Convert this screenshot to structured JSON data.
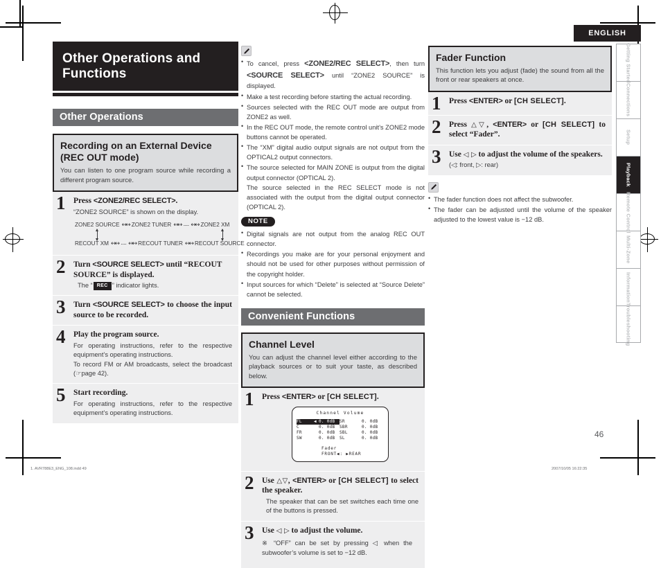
{
  "page": {
    "language_banner": "ENGLISH",
    "page_number": "46",
    "footer_left": "1. AVR788E3_ENG_108.indd    49",
    "footer_right": "2007/10/05   16:22:35"
  },
  "sidebar": {
    "tabs": [
      {
        "label": "Getting Started",
        "active": false
      },
      {
        "label": "Connections",
        "active": false
      },
      {
        "label": "Setup",
        "active": false
      },
      {
        "label": "Playback",
        "active": true
      },
      {
        "label": "Remote Control",
        "active": false
      },
      {
        "label": "Multi-Zone",
        "active": false
      },
      {
        "label": "Information",
        "active": false
      },
      {
        "label": "Troubleshooting",
        "active": false
      }
    ]
  },
  "chapter": {
    "title_line1": "Other Operations and",
    "title_line2": "Functions"
  },
  "left_column": {
    "section_bar": "Other Operations",
    "feature": {
      "title_line1": "Recording on an External Device",
      "title_line2": "(REC OUT mode)",
      "description": "You can listen to one program source while recording a different program source."
    },
    "steps": [
      {
        "num": "1",
        "head_prefix": "Press ",
        "head_key": "<ZONE2/REC SELECT>",
        "head_suffix": ".",
        "body": "“ZONE2 SOURCE” is shown on the display."
      },
      {
        "num": "2",
        "head_prefix": "Turn ",
        "head_key": "<SOURCE SELECT>",
        "head_suffix": " until “RECOUT SOURCE” is displayed.",
        "body_before": "The “",
        "body_chip": "REC",
        "body_after": "” indicator lights."
      },
      {
        "num": "3",
        "head_prefix": "Turn ",
        "head_key": "<SOURCE SELECT>",
        "head_suffix": " to choose the input source to be recorded.",
        "body": ""
      },
      {
        "num": "4",
        "head_plain": "Play the program source.",
        "body": "For operating instructions, refer to the respective equipment’s operating instructions.",
        "body2_before": "To record FM or AM broadcasts, select the broadcast (",
        "body2_after": "page 42)."
      },
      {
        "num": "5",
        "head_plain": "Start recording.",
        "body": "For operating instructions, refer to the respective equipment’s operating instructions."
      }
    ],
    "flow_diagram": {
      "row1": [
        "ZONE2 SOURCE",
        "ZONE2 TUNER",
        "····",
        "ZONE2 XM"
      ],
      "row2": [
        "RECOUT XM",
        "····",
        "RECOUT TUNER",
        "RECOUT SOURCE"
      ]
    }
  },
  "mid_column": {
    "memo_bullets": [
      {
        "parts": [
          {
            "t": "To cancel, press ",
            "style": "normal"
          },
          {
            "t": "<ZONE2/REC SELECT>",
            "style": "key"
          },
          {
            "t": ", then turn ",
            "style": "normal"
          },
          {
            "t": "<SOURCE SELECT>",
            "style": "key"
          },
          {
            "t": " until “ZONE2 SOURCE” is displayed.",
            "style": "normal"
          }
        ]
      },
      {
        "text": "Make a test recording before starting the actual recording."
      },
      {
        "text": "Sources selected with the REC OUT mode are output from ZONE2 as well."
      },
      {
        "text": "In the REC OUT mode, the remote control unit’s ZONE2 mode buttons cannot be operated."
      },
      {
        "text": "The “XM” digital audio output signals are not output from the OPTICAL2 output connectors."
      },
      {
        "text": "The source selected for MAIN ZONE is output from the digital output connector (OPTICAL 2).",
        "sub": "The source selected in the REC SELECT mode is not associated with the output from the digital output connector (OPTICAL 2)."
      }
    ],
    "note_tag": "NOTE",
    "note_bullets": [
      {
        "text": "Digital signals are not output from the analog REC OUT connector."
      },
      {
        "text": "Recordings you make are for your personal enjoyment and should not be used for other purposes without permission of the copyright holder."
      },
      {
        "text": "Input sources for which “Delete” is selected at “Source Delete” cannot be selected."
      }
    ],
    "section_bar": "Convenient Functions",
    "feature": {
      "title": "Channel Level",
      "description": "You can adjust the channel level either according to the playback sources or to suit your taste, as described below."
    },
    "steps": [
      {
        "num": "1",
        "head_prefix": "Press ",
        "head_key1": "<ENTER>",
        "head_mid": " or ",
        "head_key2": "[CH SELECT]",
        "head_suffix": "."
      },
      {
        "num": "2",
        "head_prefix": "Use ",
        "head_arrows": "△▽",
        "head_mid1": ", ",
        "head_key1": "<ENTER>",
        "head_mid2": " or ",
        "head_key2": "[CH SELECT]",
        "head_suffix": " to select the speaker.",
        "body": "The speaker that can be set switches each time one of the buttons is pressed."
      },
      {
        "num": "3",
        "head_prefix": "Use ",
        "head_arrows": "◁ ▷",
        "head_suffix": " to adjust the volume."
      }
    ],
    "asterisk_note": "※ “OFF” can be set by pressing ◁ when the subwoofer’s volume is set to −12 dB.",
    "osd": {
      "title": "Channel Volume",
      "rows": [
        {
          "left_label": "FL",
          "left_arrow": "◀",
          "left_value": "0. 0dB",
          "left_selected": true,
          "right_label": "SR",
          "right_value": "0. 0dB"
        },
        {
          "left_label": "C",
          "left_arrow": "",
          "left_value": "0. 0dB",
          "left_selected": false,
          "right_label": "SBR",
          "right_value": "0. 0dB"
        },
        {
          "left_label": "FR",
          "left_arrow": "",
          "left_value": "0. 0dB",
          "left_selected": false,
          "right_label": "SBL",
          "right_value": "0. 0dB"
        },
        {
          "left_label": "SW",
          "left_arrow": "",
          "left_value": "0. 0dB",
          "left_selected": false,
          "right_label": "SL",
          "right_value": "0. 0dB"
        }
      ],
      "fader_label": "Fader",
      "fader_value": "FRONT◀: ▶REAR"
    }
  },
  "right_column": {
    "feature": {
      "title": "Fader Function",
      "description": "This function lets you adjust (fade) the sound from all the front or rear speakers at once."
    },
    "steps": [
      {
        "num": "1",
        "head_prefix": "Press ",
        "head_key1": "<ENTER>",
        "head_mid": " or ",
        "head_key2": "[CH SELECT]",
        "head_suffix": "."
      },
      {
        "num": "2",
        "head_prefix": "Press ",
        "head_arrows": "△▽",
        "head_mid1": ", ",
        "head_key1": "<ENTER>",
        "head_mid2": " or ",
        "head_key2": "[CH SELECT]",
        "head_suffix": " to select “Fader”."
      },
      {
        "num": "3",
        "head_prefix": "Use ",
        "head_arrows": "◁ ▷",
        "head_suffix": " to adjust the volume of the speakers.",
        "body": "(◁: front, ▷: rear)"
      }
    ],
    "memo_bullets": [
      {
        "text": "The fader function does not affect the subwoofer."
      },
      {
        "text": "The fader can be adjusted until the volume of the speaker adjusted to the lowest value is −12 dB."
      }
    ]
  }
}
